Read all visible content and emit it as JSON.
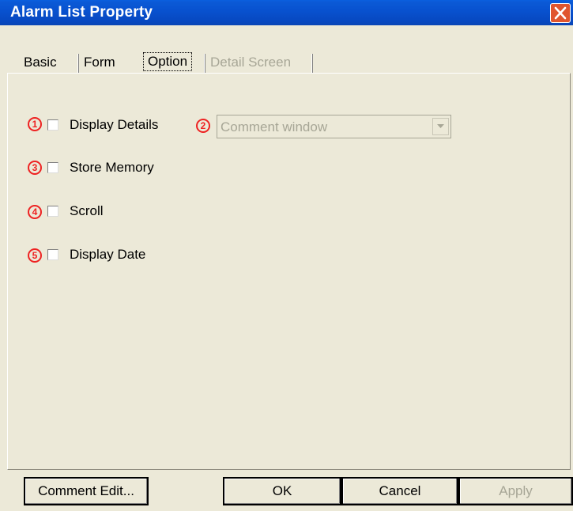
{
  "window": {
    "title": "Alarm List Property",
    "close_icon": "close-icon"
  },
  "tabs": [
    {
      "label": "Basic",
      "state": "normal"
    },
    {
      "label": "Form",
      "state": "normal"
    },
    {
      "label": "Option",
      "state": "selected"
    },
    {
      "label": "Detail Screen",
      "state": "disabled"
    }
  ],
  "options": {
    "display_details": {
      "badge": "1",
      "label": "Display Details",
      "checked": false
    },
    "display_mode": {
      "badge": "2",
      "value": "Comment window",
      "enabled": false
    },
    "store_memory": {
      "badge": "3",
      "label": "Store Memory",
      "checked": false
    },
    "scroll": {
      "badge": "4",
      "label": "Scroll",
      "checked": false
    },
    "display_date": {
      "badge": "5",
      "label": "Display Date",
      "checked": false
    }
  },
  "buttons": {
    "comment_edit": "Comment Edit...",
    "ok": "OK",
    "cancel": "Cancel",
    "apply": "Apply"
  },
  "colors": {
    "titlebar": "#0852d0",
    "dialog_bg": "#ece9d8",
    "badge": "#ee2222",
    "disabled_text": "#a7a696",
    "close_button": "#e0552e"
  }
}
